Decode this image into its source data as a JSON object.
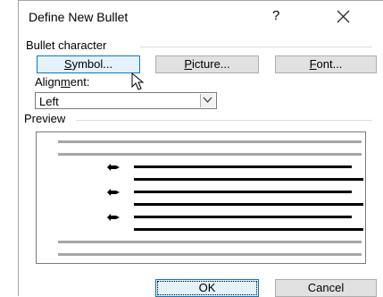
{
  "dialog": {
    "title": "Define New Bullet",
    "help": "?"
  },
  "bullet_character": {
    "group_label": "Bullet character",
    "symbol_button": {
      "mnemonic": "S",
      "rest": "ymbol..."
    },
    "picture_button": {
      "mnemonic": "P",
      "rest": "icture..."
    },
    "font_button": {
      "mnemonic": "F",
      "rest": "ont..."
    }
  },
  "alignment": {
    "label_pre": "Align",
    "label_mn": "m",
    "label_post": "ent:",
    "value": "Left"
  },
  "preview": {
    "group_label": "Preview",
    "line_color_grey": "#a6a6a6",
    "line_color_dark": "#000000",
    "bullet_symbol": "diamond-arrow-bullet"
  },
  "footer": {
    "ok_label": "OK",
    "cancel_label": "Cancel"
  },
  "colors": {
    "focus_border": "#0078d7",
    "button_face": "#e1e1e1"
  },
  "icons": [
    "close-icon",
    "chevron-down-icon",
    "mouse-pointer-icon",
    "bullet-icon"
  ]
}
